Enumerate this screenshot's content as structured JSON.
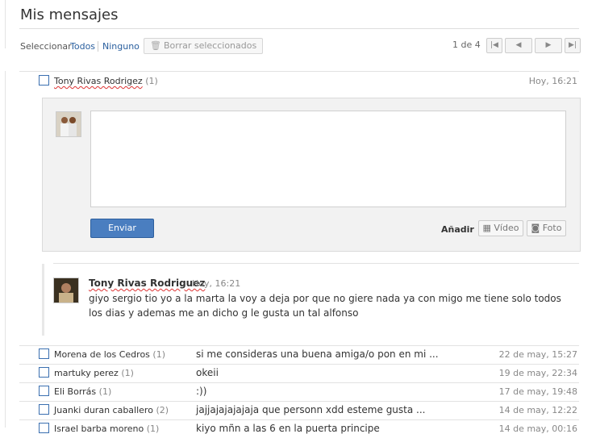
{
  "page": {
    "title": "Mis mensajes"
  },
  "toolbar": {
    "select_label": "Seleccionar",
    "all_label": "Todos",
    "none_label": "Ninguno",
    "delete_label": "Borrar seleccionados",
    "pager_text": "1 de 4"
  },
  "pager_icons": [
    "first-page-icon",
    "prev-page-icon",
    "next-page-icon",
    "last-page-icon"
  ],
  "open_conversation": {
    "name": "Tony Rivas Rodrigez",
    "count": "(1)",
    "date": "Hoy, 16:21",
    "reply": {
      "send_label": "Enviar",
      "add_label": "Añadir",
      "video_label": "Vídeo",
      "photo_label": "Foto"
    },
    "message": {
      "author": "Tony Rivas Rodriguez",
      "time": "Hoy, 16:21",
      "body": "giyo sergio tio yo a la marta la voy a deja por que no giere nada ya con migo me tiene solo todos los dias y ademas me an dicho g le gusta un tal alfonso"
    }
  },
  "conversations": [
    {
      "name": "Morena de los Cedros",
      "count": "(1)",
      "preview": "si me consideras una buena amiga/o pon en mi ...",
      "date": "22 de may, 15:27"
    },
    {
      "name": "martuky perez",
      "count": "(1)",
      "preview": "okeii",
      "date": "19 de may, 22:34"
    },
    {
      "name": "Eli Borrás",
      "count": "(1)",
      "preview": ":))",
      "date": "17 de may, 19:48"
    },
    {
      "name": "Juanki duran caballero",
      "count": "(2)",
      "preview": "jajjajajajajaja que personn xdd esteme gusta ...",
      "date": "14 de may, 12:22"
    },
    {
      "name": "Israel barba moreno",
      "count": "(1)",
      "preview": "kiyo mñn a las 6 en la puerta principe",
      "date": "14 de may, 00:16"
    }
  ],
  "colors": {
    "link": "#2a5f9e",
    "send_button": "#4a7ec0",
    "checkbox": "#3a6fb0"
  }
}
